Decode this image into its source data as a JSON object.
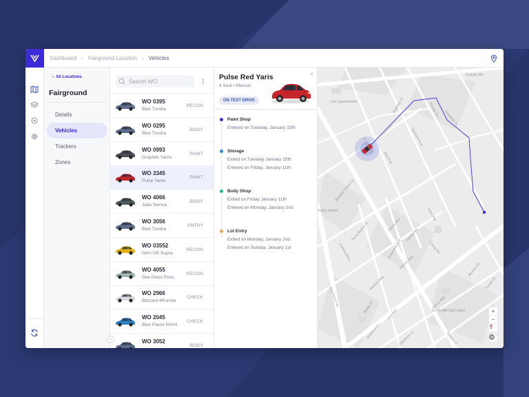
{
  "breadcrumb": [
    "Dashboard",
    "Fairground Location",
    "Vehicles"
  ],
  "nav": {
    "back_label": "All Locations",
    "title": "Fairground",
    "items": [
      {
        "label": "Details",
        "active": false
      },
      {
        "label": "Vehicles",
        "active": true
      },
      {
        "label": "Trackers",
        "active": false
      },
      {
        "label": "Zones",
        "active": false
      }
    ]
  },
  "search": {
    "placeholder": "Search WO"
  },
  "vehicles": [
    {
      "wo": "WO 0395",
      "name": "Blue Tundra",
      "status": "RECON",
      "color": "#5d6f8d"
    },
    {
      "wo": "WO 0295",
      "name": "Blue Tundra",
      "status": "BODY",
      "color": "#5d6f8d"
    },
    {
      "wo": "WO 0993",
      "name": "Graphite Yarris",
      "status": "PAINT",
      "color": "#4a4d55"
    },
    {
      "wo": "WO 3345",
      "name": "Pulse Yarris",
      "status": "PAINT",
      "color": "#c8242c",
      "selected": true
    },
    {
      "wo": "WO 4066",
      "name": "Jade Sienna",
      "status": "BODY",
      "color": "#4f5a5a"
    },
    {
      "wo": "WO 3056",
      "name": "Blue Tundra",
      "status": "ENTRY",
      "color": "#5d6f8d"
    },
    {
      "wo": "WO 03552",
      "name": "Nitro GR Supra",
      "status": "RECON",
      "color": "#e2b316"
    },
    {
      "wo": "WO 4055",
      "name": "Sea Glass Prius",
      "status": "RECON",
      "color": "#9fb3b1"
    },
    {
      "wo": "WO 2966",
      "name": "Blizzard 4Runner",
      "status": "CHECK",
      "color": "#d9dadd"
    },
    {
      "wo": "WO 2045",
      "name": "Blue Flame RAV4",
      "status": "CHECK",
      "color": "#2f7fc2"
    },
    {
      "wo": "WO 3052",
      "name": "",
      "status": "BODY",
      "color": "#5d6f8d"
    }
  ],
  "detail": {
    "title": "Pulse Red Yaris",
    "subtitle": "4 Seat • Manual",
    "badge": "ON TEST DRIVE",
    "close": "×",
    "timeline": [
      {
        "title": "Paint Shop",
        "lines": [
          "Entered on Tuesday, January 15th"
        ],
        "color": "#3c2bd6"
      },
      {
        "title": "Storage",
        "lines": [
          "Exited on Tuesday January 15th",
          "Entered on Friday, January 11th"
        ],
        "color": "#2a8ad6"
      },
      {
        "title": "Body Shop",
        "lines": [
          "Exited on Friday January 11th",
          "Entered on Monday, January 2nd"
        ],
        "color": "#1fb59a"
      },
      {
        "title": "Lot Entry",
        "lines": [
          "Exited on Monday, January 2nd",
          "Entered on Sunday, January 1st"
        ],
        "color": "#f0a04b"
      }
    ]
  },
  "map": {
    "labels": [
      "Quimby Rd",
      "Lion Supermarket",
      "Edgeley Ct",
      "Pinner Ct",
      "Charbros Ct",
      "Aspen Dr",
      "Dacrone Ave",
      "S Aspen Dr",
      "Aldo Ave",
      "Bowling Green Dr",
      "Tierra Buena Dr",
      "Elleric Ave",
      "Sierra Ave",
      "Ensenada Ave",
      "Sutro Ave",
      "S King Rd",
      "Camino Rico",
      "Aldrich Way",
      "Jessica Way",
      "Monroe Dr",
      "Tuscan Dr",
      "Biddle Dr",
      "Lee Ave",
      "Barberry Ct",
      "Stephens Ln",
      "Sierra Way",
      "KLOK-AM (San Jose)",
      "Towne Ln",
      "Bayshore Fwy",
      "Valley School"
    ],
    "zoom_in": "+",
    "zoom_out": "−"
  }
}
